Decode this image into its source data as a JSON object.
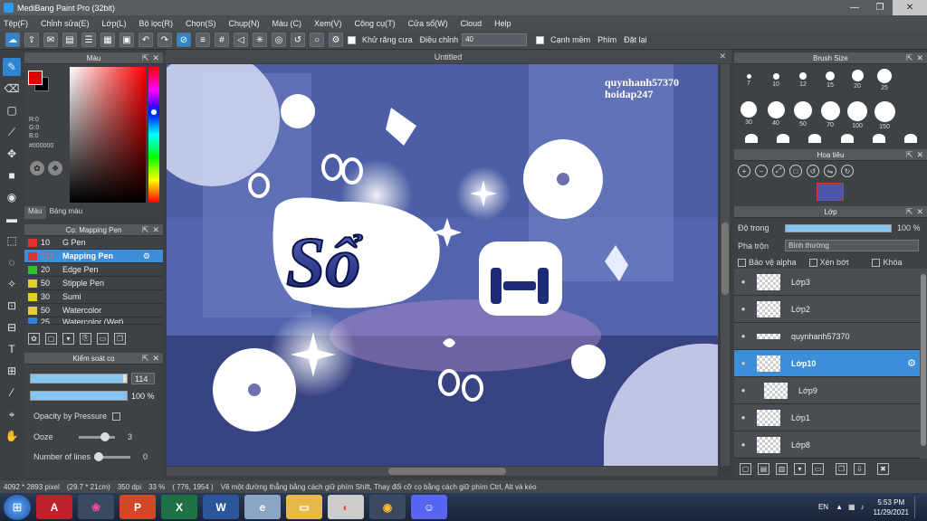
{
  "window": {
    "title": "MediBang Paint Pro (32bit)"
  },
  "menu": [
    "Tệp(F)",
    "Chỉnh sửa(E)",
    "Lớp(L)",
    "Bộ lọc(R)",
    "Chọn(S)",
    "Chụp(N)",
    "Màu (C)",
    "Xem(V)",
    "Công cụ(T)",
    "Cửa sổ(W)",
    "Cloud",
    "Help"
  ],
  "toolbar": {
    "antialias_label": "Khử răng cưa",
    "correction_label": "Điều chỉnh",
    "correction_value": "40",
    "snap_label": "Cạnh mềm",
    "key_label": "Phím",
    "reset_label": "Đặt lại"
  },
  "color_panel": {
    "title": "Màu",
    "r": "R:0",
    "g": "G:0",
    "b": "B:0",
    "hex": "#000000",
    "tab_color": "Màu",
    "tab_palette": "Bảng màu",
    "fg_color": "#e00000",
    "bg_color": "#000000"
  },
  "brush_panel": {
    "title": "Cọ: Mapping Pen",
    "items": [
      {
        "size": "10",
        "name": "G Pen",
        "color": "#e03030"
      },
      {
        "size": "114",
        "name": "Mapping Pen",
        "color": "#e03030"
      },
      {
        "size": "20",
        "name": "Edge Pen",
        "color": "#30c030"
      },
      {
        "size": "50",
        "name": "Stipple Pen",
        "color": "#e0d030"
      },
      {
        "size": "30",
        "name": "Sumi",
        "color": "#e0d030"
      },
      {
        "size": "50",
        "name": "Watercolor",
        "color": "#e0d030"
      },
      {
        "size": "25",
        "name": "Watercolor (Wet)",
        "color": "#3080e0"
      }
    ]
  },
  "brush_control": {
    "title": "Kiểm soát cọ",
    "size_value": "114",
    "opacity_value": "100 %",
    "opacity_pressure_label": "Opacity by Pressure",
    "ooze_label": "Ooze",
    "ooze_value": "3",
    "lines_label": "Number of lines",
    "lines_value": "0"
  },
  "canvas": {
    "title": "Untitled",
    "watermark_line1": "quynhanh57370",
    "watermark_line2": "hoidap247"
  },
  "brush_size_panel": {
    "title": "Brush Size",
    "sizes": [
      "7",
      "10",
      "12",
      "15",
      "20",
      "25",
      "30",
      "40",
      "50",
      "70",
      "100",
      "150"
    ]
  },
  "navigator": {
    "title": "Hoa tiêu"
  },
  "layer_panel": {
    "title": "Lớp",
    "opacity_label": "Độ trong",
    "opacity_value": "100 %",
    "blend_label": "Pha trộn",
    "blend_value": "Bình thường",
    "protect_alpha": "Bảo vệ alpha",
    "clipping": "Xén bớt",
    "lock": "Khóa",
    "layers": [
      "Lớp3",
      "Lớp2",
      "quynhanh57370",
      "Lớp10",
      "Lớp9",
      "Lớp1",
      "Lớp8"
    ]
  },
  "status": {
    "size": "4092 * 2893 pixel",
    "cm": "(29.7 * 21cm)",
    "dpi": "350 dpi",
    "zoom": "33 %",
    "coords": "( 776, 1954 )",
    "hint": "Vẽ một đường thẳng bằng cách giữ phím Shift, Thay đổi cỡ cọ bằng cách giữ phím Ctrl, Alt và kéo"
  },
  "taskbar": {
    "lang": "EN",
    "time": "5:53 PM",
    "date": "11/29/2021",
    "apps": [
      "A",
      "P",
      "X",
      "W"
    ]
  }
}
